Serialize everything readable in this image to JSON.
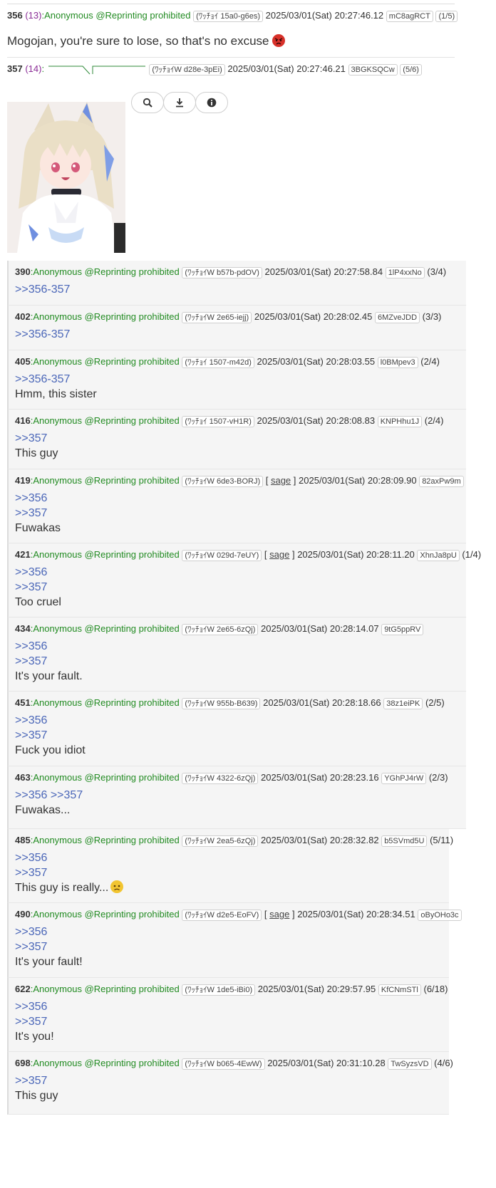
{
  "post356": {
    "num": "356",
    "count": "(13)",
    "name": ":Anonymous @Reprinting prohibited",
    "id_tag": "(ﾜｯﾁｮｲ 15a0-g6es)",
    "date": "2025/03/01(Sat) 20:27:46.12",
    "uid": "mC8agRCT",
    "seq": "(1/5)",
    "body": "Mogojan, you're sure to lose, so that's no excuse",
    "emoji": "angry-face-icon"
  },
  "post357": {
    "num": "357",
    "count": "(14)",
    "name": ":",
    "id_tag": "(ﾜｯﾁｮｲW d28e-3pEi)",
    "date": "2025/03/01(Sat) 20:27:46.21",
    "uid": "3BGKSQCw",
    "seq": "(5/6)",
    "buttons": [
      "search-icon",
      "download-icon",
      "info-icon"
    ]
  },
  "replies": [
    {
      "num": "390",
      "name": ":Anonymous @Reprinting prohibited",
      "id_tag": "(ﾜｯﾁｮｲW b57b-pdOV)",
      "sage": "",
      "date": "2025/03/01(Sat) 20:27:58.84",
      "uid": "1lP4xxNo",
      "seq": "(3/4)",
      "refs": [
        ">>356-357"
      ],
      "text": ""
    },
    {
      "num": "402",
      "name": ":Anonymous @Reprinting prohibited",
      "id_tag": "(ﾜｯﾁｮｲW 2e65-iejj)",
      "sage": "",
      "date": "2025/03/01(Sat) 20:28:02.45",
      "uid": "6MZveJDD",
      "seq": "(3/3)",
      "refs": [
        ">>356-357"
      ],
      "text": ""
    },
    {
      "num": "405",
      "name": ":Anonymous @Reprinting prohibited",
      "id_tag": "(ﾜｯﾁｮｲ 1507-m42d)",
      "sage": "",
      "date": "2025/03/01(Sat) 20:28:03.55",
      "uid": "l0BMpev3",
      "seq": "(2/4)",
      "refs": [
        ">>356-357"
      ],
      "text": "Hmm, this sister"
    },
    {
      "num": "416",
      "name": ":Anonymous @Reprinting prohibited",
      "id_tag": "(ﾜｯﾁｮｲ 1507-vH1R)",
      "sage": "",
      "date": "2025/03/01(Sat) 20:28:08.83",
      "uid": "KNPHhu1J",
      "seq": "(2/4)",
      "refs": [
        ">>357"
      ],
      "text": "This guy"
    },
    {
      "num": "419",
      "name": ":Anonymous @Reprinting prohibited",
      "id_tag": "(ﾜｯﾁｮｲW 6de3-BORJ)",
      "sage": "sage",
      "date": "2025/03/01(Sat) 20:28:09.90",
      "uid": "82axPw9m",
      "seq": "",
      "refs": [
        ">>356",
        ">>357"
      ],
      "text": "Fuwakas"
    },
    {
      "num": "421",
      "name": ":Anonymous @Reprinting prohibited",
      "id_tag": "(ﾜｯﾁｮｲW 029d-7eUY)",
      "sage": "sage",
      "date": "2025/03/01(Sat) 20:28:11.20",
      "uid": "XhnJa8pU",
      "seq": "(1/4)",
      "refs": [
        ">>356",
        ">>357"
      ],
      "text": "Too cruel"
    },
    {
      "num": "434",
      "name": ":Anonymous @Reprinting prohibited",
      "id_tag": "(ﾜｯﾁｮｲW 2e65-6zQj)",
      "sage": "",
      "date": "2025/03/01(Sat) 20:28:14.07",
      "uid": "9tG5ppRV",
      "seq": "",
      "refs": [
        ">>356",
        ">>357"
      ],
      "text": "It's your fault."
    },
    {
      "num": "451",
      "name": ":Anonymous @Reprinting prohibited",
      "id_tag": "(ﾜｯﾁｮｲW 955b-B639)",
      "sage": "",
      "date": "2025/03/01(Sat) 20:28:18.66",
      "uid": "38z1eiPK",
      "seq": "(2/5)",
      "refs": [
        ">>356",
        ">>357"
      ],
      "text": "Fuck you idiot"
    },
    {
      "num": "463",
      "name": ":Anonymous @Reprinting prohibited",
      "id_tag": "(ﾜｯﾁｮｲW 4322-6zQj)",
      "sage": "",
      "date": "2025/03/01(Sat) 20:28:23.16",
      "uid": "YGhPJ4rW",
      "seq": "(2/3)",
      "refs": [
        ">>356 >>357"
      ],
      "text": "Fuwakas..."
    },
    {
      "num": "485",
      "name": ":Anonymous @Reprinting prohibited",
      "id_tag": "(ﾜｯﾁｮｲW 2ea5-6zQj)",
      "sage": "",
      "date": "2025/03/01(Sat) 20:28:32.82",
      "uid": "b5SVmd5U",
      "seq": "(5/11)",
      "refs": [
        ">>356",
        ">>357"
      ],
      "text": "This guy is really...",
      "emoji": "sad-face-icon"
    },
    {
      "num": "490",
      "name": ":Anonymous @Reprinting prohibited",
      "id_tag": "(ﾜｯﾁｮｲW d2e5-EoFV)",
      "sage": "sage",
      "date": "2025/03/01(Sat) 20:28:34.51",
      "uid": "oByOHo3c",
      "seq": "",
      "refs": [
        ">>356",
        ">>357"
      ],
      "text": "It's your fault!"
    },
    {
      "num": "622",
      "name": ":Anonymous @Reprinting prohibited",
      "id_tag": "(ﾜｯﾁｮｲW 1de5-iBi0)",
      "sage": "",
      "date": "2025/03/01(Sat) 20:29:57.95",
      "uid": "KfCNmSTl",
      "seq": "(6/18)",
      "refs": [
        ">>356",
        ">>357"
      ],
      "text": "It's you!"
    },
    {
      "num": "698",
      "name": ":Anonymous @Reprinting prohibited",
      "id_tag": "(ﾜｯﾁｮｲW b065-4EwW)",
      "sage": "",
      "date": "2025/03/01(Sat) 20:31:10.28",
      "uid": "TwSyzsVD",
      "seq": "(4/6)",
      "refs": [
        ">>357"
      ],
      "text": "This guy"
    }
  ],
  "colors": {
    "name": "#228b22",
    "count": "#8a2c96",
    "anchor": "#4a66b8",
    "reply_bg": "#f5f5f5"
  }
}
